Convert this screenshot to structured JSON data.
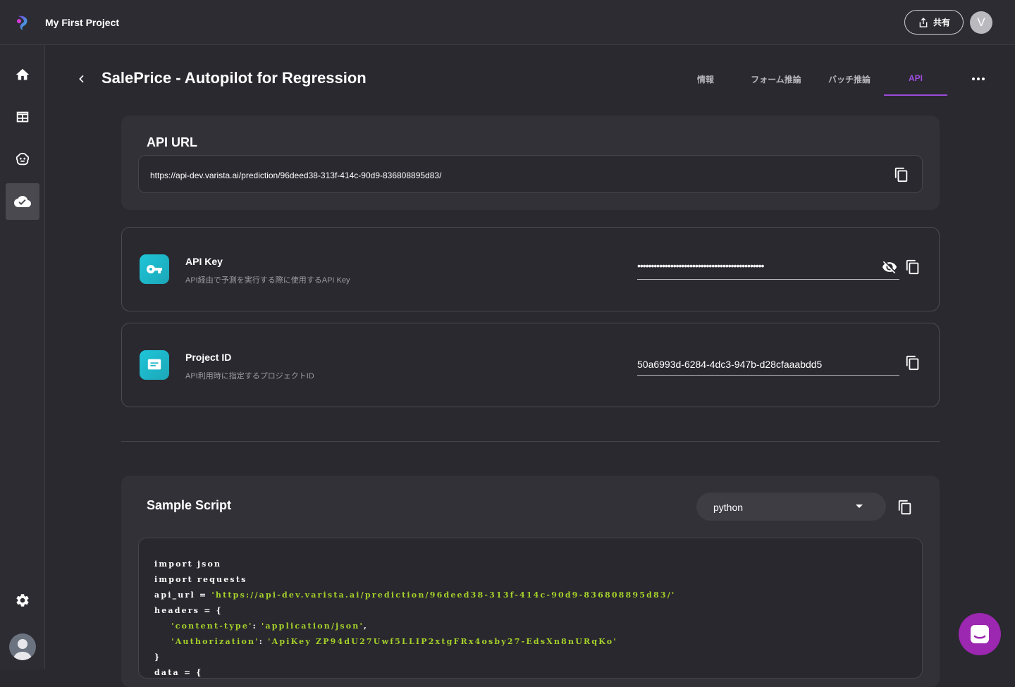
{
  "header": {
    "project_title": "My First Project",
    "share_label": "共有",
    "user_initial": "V"
  },
  "sidebar": {
    "items": [
      {
        "icon": "home-icon"
      },
      {
        "icon": "table-icon"
      },
      {
        "icon": "brain-icon"
      },
      {
        "icon": "cloud-check-icon",
        "active": true
      }
    ],
    "settings_icon": "gear-icon"
  },
  "page": {
    "title": "SalePrice - Autopilot for Regression",
    "tabs": [
      {
        "label": "情報"
      },
      {
        "label": "フォーム推論"
      },
      {
        "label": "バッチ推論"
      },
      {
        "label": "API",
        "active": true
      }
    ]
  },
  "api_url": {
    "title": "API URL",
    "value": "https://api-dev.varista.ai/prediction/96deed38-313f-414c-90d9-836808895d83/"
  },
  "api_key": {
    "title": "API Key",
    "subtitle": "API経由で予測を実行する際に使用するAPI Key",
    "masked_value": "••••••••••••••••••••••••••••••••••••••••••••••"
  },
  "project_id": {
    "title": "Project ID",
    "subtitle": "API利用時に指定するプロジェクトID",
    "value": "50a6993d-6284-4dc3-947b-d28cfaaabdd5"
  },
  "sample_script": {
    "title": "Sample Script",
    "language": "python",
    "lines": {
      "l1": "import json",
      "l2": "import requests",
      "l3_key": "api_url = ",
      "l3_val": "'https://api-dev.varista.ai/prediction/96deed38-313f-414c-90d9-836808895d83/'",
      "l4": "headers = {",
      "l5_key": "'content-type'",
      "l5_sep": ": ",
      "l5_val": "'application/json'",
      "l5_end": ",",
      "l6_key": "'Authorization'",
      "l6_sep": ": ",
      "l6_val": "'ApiKey ZP94dU27Uwf5LLIP2xtgFRx4osby27-EdsXn8nURqKo'",
      "l7": "}",
      "l8": "data = {"
    }
  }
}
